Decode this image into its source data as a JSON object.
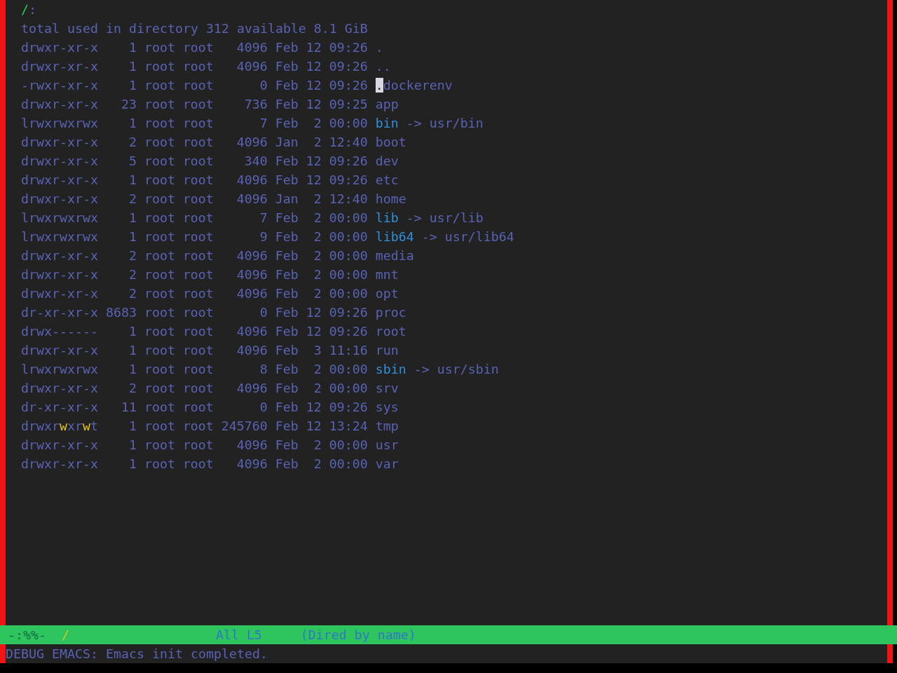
{
  "buffer": {
    "header": {
      "path": "/",
      "suffix": ":"
    },
    "summary": "total used in directory 312 available 8.1 GiB",
    "entries": [
      {
        "permissions": "drwxr-xr-x",
        "links": "1",
        "owner": "root",
        "group": "root",
        "size": "4096",
        "month": "Feb",
        "day": "12",
        "time": "09:26",
        "name": ".",
        "kind": "directory",
        "world_writable": false,
        "has_cursor": false
      },
      {
        "permissions": "drwxr-xr-x",
        "links": "1",
        "owner": "root",
        "group": "root",
        "size": "4096",
        "month": "Feb",
        "day": "12",
        "time": "09:26",
        "name": "..",
        "kind": "directory",
        "world_writable": false,
        "has_cursor": false
      },
      {
        "permissions": "-rwxr-xr-x",
        "links": "1",
        "owner": "root",
        "group": "root",
        "size": "0",
        "month": "Feb",
        "day": "12",
        "time": "09:26",
        "name": ".dockerenv",
        "kind": "file",
        "world_writable": false,
        "has_cursor": true
      },
      {
        "permissions": "drwxr-xr-x",
        "links": "23",
        "owner": "root",
        "group": "root",
        "size": "736",
        "month": "Feb",
        "day": "12",
        "time": "09:25",
        "name": "app",
        "kind": "directory",
        "world_writable": false,
        "has_cursor": false
      },
      {
        "permissions": "lrwxrwxrwx",
        "links": "1",
        "owner": "root",
        "group": "root",
        "size": "7",
        "month": "Feb",
        "day": "2",
        "time": "00:00",
        "name": "bin",
        "kind": "symlink",
        "arrow": "->",
        "target": "usr/bin",
        "world_writable": false,
        "has_cursor": false
      },
      {
        "permissions": "drwxr-xr-x",
        "links": "2",
        "owner": "root",
        "group": "root",
        "size": "4096",
        "month": "Jan",
        "day": "2",
        "time": "12:40",
        "name": "boot",
        "kind": "directory",
        "world_writable": false,
        "has_cursor": false
      },
      {
        "permissions": "drwxr-xr-x",
        "links": "5",
        "owner": "root",
        "group": "root",
        "size": "340",
        "month": "Feb",
        "day": "12",
        "time": "09:26",
        "name": "dev",
        "kind": "directory",
        "world_writable": false,
        "has_cursor": false
      },
      {
        "permissions": "drwxr-xr-x",
        "links": "1",
        "owner": "root",
        "group": "root",
        "size": "4096",
        "month": "Feb",
        "day": "12",
        "time": "09:26",
        "name": "etc",
        "kind": "directory",
        "world_writable": false,
        "has_cursor": false
      },
      {
        "permissions": "drwxr-xr-x",
        "links": "2",
        "owner": "root",
        "group": "root",
        "size": "4096",
        "month": "Jan",
        "day": "2",
        "time": "12:40",
        "name": "home",
        "kind": "directory",
        "world_writable": false,
        "has_cursor": false
      },
      {
        "permissions": "lrwxrwxrwx",
        "links": "1",
        "owner": "root",
        "group": "root",
        "size": "7",
        "month": "Feb",
        "day": "2",
        "time": "00:00",
        "name": "lib",
        "kind": "symlink",
        "arrow": "->",
        "target": "usr/lib",
        "world_writable": false,
        "has_cursor": false
      },
      {
        "permissions": "lrwxrwxrwx",
        "links": "1",
        "owner": "root",
        "group": "root",
        "size": "9",
        "month": "Feb",
        "day": "2",
        "time": "00:00",
        "name": "lib64",
        "kind": "symlink",
        "arrow": "->",
        "target": "usr/lib64",
        "world_writable": false,
        "has_cursor": false
      },
      {
        "permissions": "drwxr-xr-x",
        "links": "2",
        "owner": "root",
        "group": "root",
        "size": "4096",
        "month": "Feb",
        "day": "2",
        "time": "00:00",
        "name": "media",
        "kind": "directory",
        "world_writable": false,
        "has_cursor": false
      },
      {
        "permissions": "drwxr-xr-x",
        "links": "2",
        "owner": "root",
        "group": "root",
        "size": "4096",
        "month": "Feb",
        "day": "2",
        "time": "00:00",
        "name": "mnt",
        "kind": "directory",
        "world_writable": false,
        "has_cursor": false
      },
      {
        "permissions": "drwxr-xr-x",
        "links": "2",
        "owner": "root",
        "group": "root",
        "size": "4096",
        "month": "Feb",
        "day": "2",
        "time": "00:00",
        "name": "opt",
        "kind": "directory",
        "world_writable": false,
        "has_cursor": false
      },
      {
        "permissions": "dr-xr-xr-x",
        "links": "8683",
        "owner": "root",
        "group": "root",
        "size": "0",
        "month": "Feb",
        "day": "12",
        "time": "09:26",
        "name": "proc",
        "kind": "directory",
        "world_writable": false,
        "has_cursor": false
      },
      {
        "permissions": "drwx------",
        "links": "1",
        "owner": "root",
        "group": "root",
        "size": "4096",
        "month": "Feb",
        "day": "12",
        "time": "09:26",
        "name": "root",
        "kind": "directory",
        "world_writable": false,
        "has_cursor": false
      },
      {
        "permissions": "drwxr-xr-x",
        "links": "1",
        "owner": "root",
        "group": "root",
        "size": "4096",
        "month": "Feb",
        "day": "3",
        "time": "11:16",
        "name": "run",
        "kind": "directory",
        "world_writable": false,
        "has_cursor": false
      },
      {
        "permissions": "lrwxrwxrwx",
        "links": "1",
        "owner": "root",
        "group": "root",
        "size": "8",
        "month": "Feb",
        "day": "2",
        "time": "00:00",
        "name": "sbin",
        "kind": "symlink",
        "arrow": "->",
        "target": "usr/sbin",
        "world_writable": false,
        "has_cursor": false
      },
      {
        "permissions": "drwxr-xr-x",
        "links": "2",
        "owner": "root",
        "group": "root",
        "size": "4096",
        "month": "Feb",
        "day": "2",
        "time": "00:00",
        "name": "srv",
        "kind": "directory",
        "world_writable": false,
        "has_cursor": false
      },
      {
        "permissions": "dr-xr-xr-x",
        "links": "11",
        "owner": "root",
        "group": "root",
        "size": "0",
        "month": "Feb",
        "day": "12",
        "time": "09:26",
        "name": "sys",
        "kind": "directory",
        "world_writable": false,
        "has_cursor": false
      },
      {
        "permissions": "drwxrwxrwt",
        "links": "1",
        "owner": "root",
        "group": "root",
        "size": "245760",
        "month": "Feb",
        "day": "12",
        "time": "13:24",
        "name": "tmp",
        "kind": "directory",
        "world_writable": true,
        "has_cursor": false
      },
      {
        "permissions": "drwxr-xr-x",
        "links": "1",
        "owner": "root",
        "group": "root",
        "size": "4096",
        "month": "Feb",
        "day": "2",
        "time": "00:00",
        "name": "usr",
        "kind": "directory",
        "world_writable": false,
        "has_cursor": false
      },
      {
        "permissions": "drwxr-xr-x",
        "links": "1",
        "owner": "root",
        "group": "root",
        "size": "4096",
        "month": "Feb",
        "day": "2",
        "time": "00:00",
        "name": "var",
        "kind": "directory",
        "world_writable": false,
        "has_cursor": false
      }
    ]
  },
  "mode_line": {
    "status": "-:%%-",
    "buffer_name": "/",
    "position": "All L5",
    "mode": "(Dired by name)"
  },
  "echo_area": {
    "message": "DEBUG EMACS: Emacs init completed."
  }
}
